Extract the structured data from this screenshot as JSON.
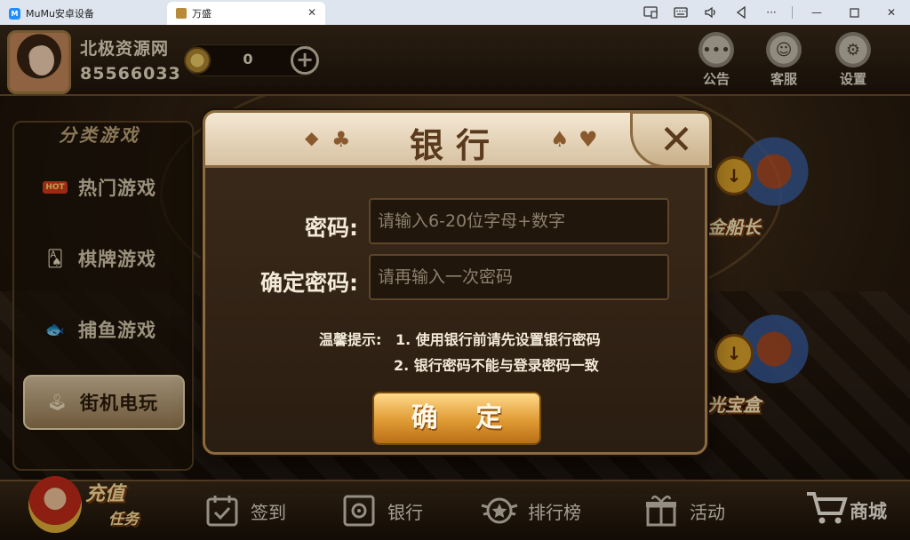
{
  "window": {
    "tabs": [
      {
        "label": "MuMu安卓设备",
        "icon": "mumu-logo"
      },
      {
        "label": "万盛",
        "icon": "game-logo",
        "active": true
      }
    ],
    "controls": [
      "screenshot-icon",
      "keyboard-icon",
      "volume-icon",
      "back-icon",
      "more-icon",
      "minimize-icon",
      "maximize-icon",
      "close-icon"
    ]
  },
  "player": {
    "name": "北极资源网",
    "id": "85566033",
    "coins": "0"
  },
  "top_buttons": [
    {
      "label": "公告",
      "icon": "chat-bubble-icon"
    },
    {
      "label": "客服",
      "icon": "support-face-icon"
    },
    {
      "label": "设置",
      "icon": "gear-icon"
    }
  ],
  "categories": {
    "title": "分类游戏",
    "items": [
      {
        "label": "热门游戏",
        "icon": "hot-icon",
        "active": false
      },
      {
        "label": "棋牌游戏",
        "icon": "cards-icon",
        "active": false
      },
      {
        "label": "捕鱼游戏",
        "icon": "fish-icon",
        "active": false
      },
      {
        "label": "街机电玩",
        "icon": "arcade-icon",
        "active": true
      }
    ]
  },
  "game_cards": [
    {
      "label": "金船长"
    },
    {
      "label": "光宝盒"
    }
  ],
  "bottom_bar": {
    "recharge": {
      "line1": "充值",
      "line2": "任务"
    },
    "items": [
      {
        "label": "签到",
        "icon": "calendar-check-icon"
      },
      {
        "label": "银行",
        "icon": "safe-icon"
      },
      {
        "label": "排行榜",
        "icon": "rank-badge-icon"
      },
      {
        "label": "活动",
        "icon": "gift-icon"
      }
    ],
    "shop": "商城"
  },
  "bank_dialog": {
    "title": "银行",
    "password_label": "密码:",
    "password_placeholder": "请输入6-20位字母+数字",
    "confirm_label": "确定密码:",
    "confirm_placeholder": "请再输入一次密码",
    "tip_prefix": "温馨提示:",
    "tip_1": "1. 使用银行前请先设置银行密码",
    "tip_2": "2. 银行密码不能与登录密码一致",
    "confirm_button": "确 定"
  },
  "colors": {
    "accent_gold": "#e09a33",
    "panel_brown": "#3c2b1b",
    "header_cream": "#f4e7d2"
  }
}
